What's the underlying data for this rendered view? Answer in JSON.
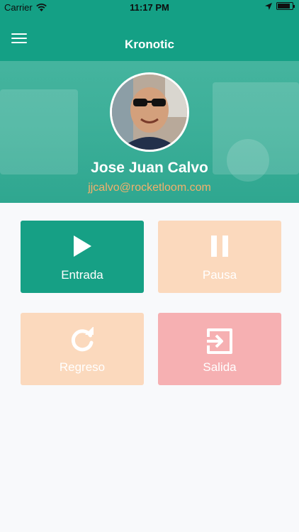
{
  "status_bar": {
    "carrier": "Carrier",
    "time": "11:17 PM",
    "battery_level": 0.85
  },
  "nav": {
    "title": "Kronotic"
  },
  "profile": {
    "name": "Jose Juan Calvo",
    "email": "jjcalvo@rocketloom.com"
  },
  "actions": [
    {
      "label": "Entrada",
      "icon": "play-icon",
      "color": "#16a085",
      "enabled": true
    },
    {
      "label": "Pausa",
      "icon": "pause-icon",
      "color": "#fbd9bd",
      "enabled": false
    },
    {
      "label": "Regreso",
      "icon": "refresh-icon",
      "color": "#fbd9bd",
      "enabled": false
    },
    {
      "label": "Salida",
      "icon": "exit-icon",
      "color": "#f6b0b2",
      "enabled": true
    }
  ],
  "colors": {
    "primary": "#14a085",
    "email": "#f4b06b",
    "background": "#f8f9fb"
  }
}
